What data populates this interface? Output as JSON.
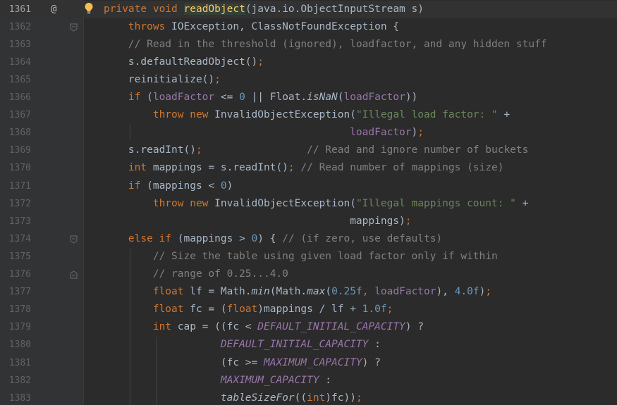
{
  "editor": {
    "lines": [
      {
        "num": "1361",
        "current": true,
        "at": "@",
        "bulb": true,
        "tokens": [
          {
            "t": "private void ",
            "c": "kw"
          },
          {
            "t": "readObject",
            "c": "fn-hl"
          },
          {
            "t": "(java.io.ObjectInputStream s)",
            "c": ""
          }
        ]
      },
      {
        "num": "1362",
        "fold": "down",
        "tokens": [
          {
            "t": "    throws ",
            "c": "kw"
          },
          {
            "t": "IOException, ClassNotFoundException {",
            "c": ""
          }
        ]
      },
      {
        "num": "1363",
        "tokens": [
          {
            "t": "    // Read in the threshold (ignored), loadfactor, and any hidden stuff",
            "c": "cm"
          }
        ]
      },
      {
        "num": "1364",
        "tokens": [
          {
            "t": "    s.defaultReadObject()",
            "c": ""
          },
          {
            "t": ";",
            "c": "kw"
          }
        ]
      },
      {
        "num": "1365",
        "tokens": [
          {
            "t": "    reinitialize()",
            "c": ""
          },
          {
            "t": ";",
            "c": "kw"
          }
        ]
      },
      {
        "num": "1366",
        "tokens": [
          {
            "t": "    if ",
            "c": "kw"
          },
          {
            "t": "(",
            "c": ""
          },
          {
            "t": "loadFactor",
            "c": "fld"
          },
          {
            "t": " <= ",
            "c": ""
          },
          {
            "t": "0",
            "c": "num"
          },
          {
            "t": " || Float.",
            "c": ""
          },
          {
            "t": "isNaN",
            "c": "ital"
          },
          {
            "t": "(",
            "c": ""
          },
          {
            "t": "loadFactor",
            "c": "fld"
          },
          {
            "t": "))",
            "c": ""
          }
        ]
      },
      {
        "num": "1367",
        "tokens": [
          {
            "t": "        throw new ",
            "c": "kw"
          },
          {
            "t": "InvalidObjectException(",
            "c": ""
          },
          {
            "t": "\"Illegal load factor: \"",
            "c": "str"
          },
          {
            "t": " +",
            "c": ""
          }
        ]
      },
      {
        "num": "1368",
        "tokens": [
          {
            "t": "                                        ",
            "c": ""
          },
          {
            "t": "loadFactor",
            "c": "fld"
          },
          {
            "t": ")",
            "c": ""
          },
          {
            "t": ";",
            "c": "kw"
          }
        ]
      },
      {
        "num": "1369",
        "tokens": [
          {
            "t": "    s.readInt()",
            "c": ""
          },
          {
            "t": ";",
            "c": "kw"
          },
          {
            "t": "                 ",
            "c": ""
          },
          {
            "t": "// Read and ignore number of buckets",
            "c": "cm"
          }
        ]
      },
      {
        "num": "1370",
        "tokens": [
          {
            "t": "    int ",
            "c": "kw"
          },
          {
            "t": "mappings = s.readInt()",
            "c": ""
          },
          {
            "t": ";",
            "c": "kw"
          },
          {
            "t": " ",
            "c": ""
          },
          {
            "t": "// Read number of mappings (size)",
            "c": "cm"
          }
        ]
      },
      {
        "num": "1371",
        "tokens": [
          {
            "t": "    if ",
            "c": "kw"
          },
          {
            "t": "(mappings < ",
            "c": ""
          },
          {
            "t": "0",
            "c": "num"
          },
          {
            "t": ")",
            "c": ""
          }
        ]
      },
      {
        "num": "1372",
        "tokens": [
          {
            "t": "        throw new ",
            "c": "kw"
          },
          {
            "t": "InvalidObjectException(",
            "c": ""
          },
          {
            "t": "\"Illegal mappings count: \"",
            "c": "str"
          },
          {
            "t": " +",
            "c": ""
          }
        ]
      },
      {
        "num": "1373",
        "tokens": [
          {
            "t": "                                        mappings)",
            "c": ""
          },
          {
            "t": ";",
            "c": "kw"
          }
        ]
      },
      {
        "num": "1374",
        "fold": "down",
        "tokens": [
          {
            "t": "    else if ",
            "c": "kw"
          },
          {
            "t": "(mappings > ",
            "c": ""
          },
          {
            "t": "0",
            "c": "num"
          },
          {
            "t": ") { ",
            "c": ""
          },
          {
            "t": "// (if zero, use defaults)",
            "c": "cm"
          }
        ]
      },
      {
        "num": "1375",
        "tokens": [
          {
            "t": "        // Size the table using given load factor only if within",
            "c": "cm"
          }
        ]
      },
      {
        "num": "1376",
        "fold": "up",
        "tokens": [
          {
            "t": "        // range of 0.25...4.0",
            "c": "cm"
          }
        ]
      },
      {
        "num": "1377",
        "tokens": [
          {
            "t": "        float ",
            "c": "kw"
          },
          {
            "t": "lf = Math.",
            "c": ""
          },
          {
            "t": "min",
            "c": "ital"
          },
          {
            "t": "(Math.",
            "c": ""
          },
          {
            "t": "max",
            "c": "ital"
          },
          {
            "t": "(",
            "c": ""
          },
          {
            "t": "0.25f",
            "c": "num"
          },
          {
            "t": ", ",
            "c": "kw"
          },
          {
            "t": "loadFactor",
            "c": "fld"
          },
          {
            "t": "), ",
            "c": ""
          },
          {
            "t": "4.0f",
            "c": "num"
          },
          {
            "t": ")",
            "c": ""
          },
          {
            "t": ";",
            "c": "kw"
          }
        ]
      },
      {
        "num": "1378",
        "tokens": [
          {
            "t": "        float ",
            "c": "kw"
          },
          {
            "t": "fc = (",
            "c": ""
          },
          {
            "t": "float",
            "c": "kw"
          },
          {
            "t": ")mappings / lf + ",
            "c": ""
          },
          {
            "t": "1.0f",
            "c": "num"
          },
          {
            "t": ";",
            "c": "kw"
          }
        ]
      },
      {
        "num": "1379",
        "tokens": [
          {
            "t": "        int ",
            "c": "kw"
          },
          {
            "t": "cap = ((fc < ",
            "c": ""
          },
          {
            "t": "DEFAULT_INITIAL_CAPACITY",
            "c": "const"
          },
          {
            "t": ") ?",
            "c": ""
          }
        ]
      },
      {
        "num": "1380",
        "tokens": [
          {
            "t": "                   ",
            "c": ""
          },
          {
            "t": "DEFAULT_INITIAL_CAPACITY",
            "c": "const"
          },
          {
            "t": " :",
            "c": ""
          }
        ]
      },
      {
        "num": "1381",
        "tokens": [
          {
            "t": "                   (fc >= ",
            "c": ""
          },
          {
            "t": "MAXIMUM_CAPACITY",
            "c": "const"
          },
          {
            "t": ") ?",
            "c": ""
          }
        ]
      },
      {
        "num": "1382",
        "tokens": [
          {
            "t": "                   ",
            "c": ""
          },
          {
            "t": "MAXIMUM_CAPACITY",
            "c": "const"
          },
          {
            "t": " :",
            "c": ""
          }
        ]
      },
      {
        "num": "1383",
        "tokens": [
          {
            "t": "                   ",
            "c": ""
          },
          {
            "t": "tableSizeFor",
            "c": "ital"
          },
          {
            "t": "((",
            "c": ""
          },
          {
            "t": "int",
            "c": "kw"
          },
          {
            "t": ")fc))",
            "c": ""
          },
          {
            "t": ";",
            "c": "kw"
          }
        ]
      }
    ]
  }
}
